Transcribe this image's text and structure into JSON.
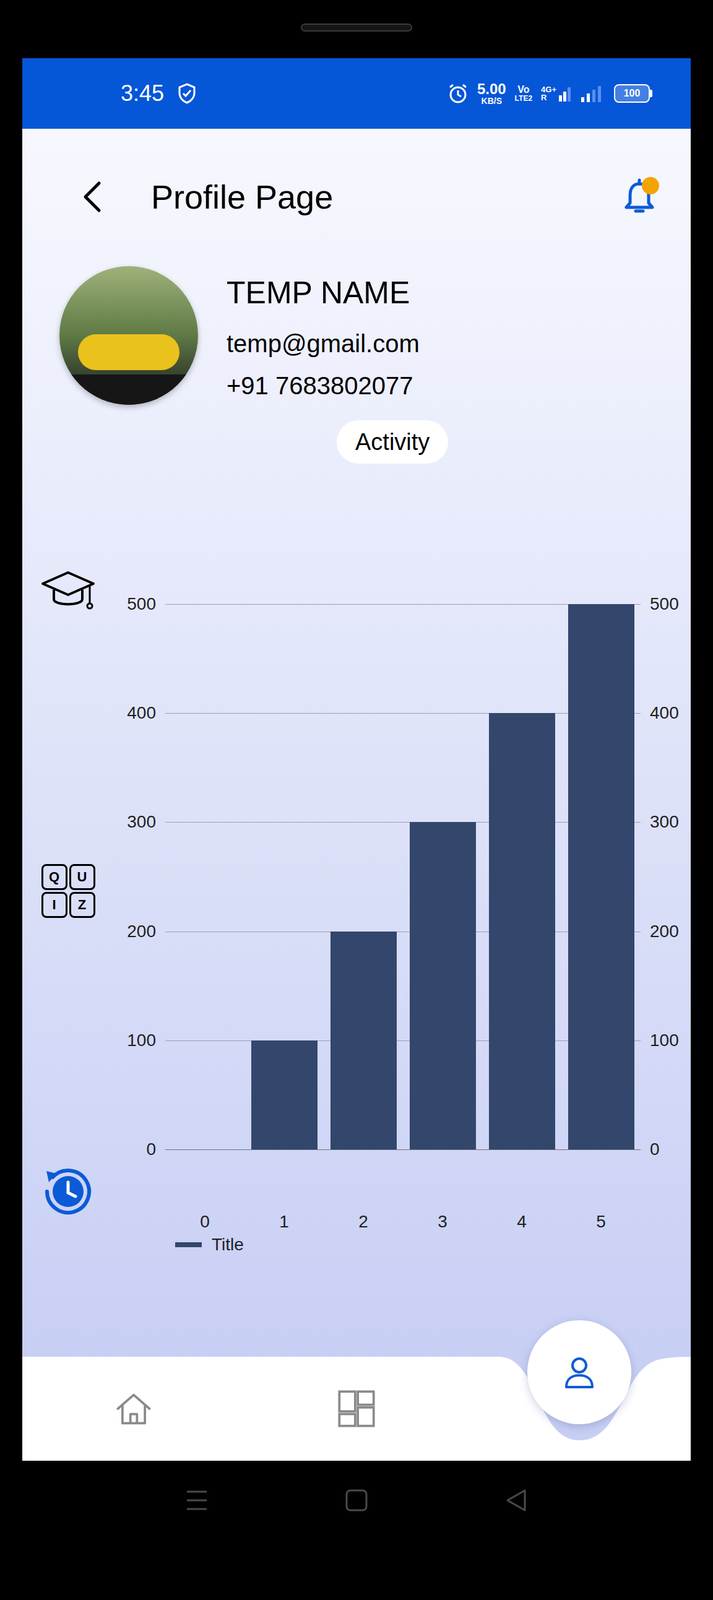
{
  "status_bar": {
    "time": "3:45",
    "speed": "5.00",
    "speed_unit": "KB/S",
    "volte": "Vo",
    "volte_sub": "LTE2",
    "network": "4G+",
    "roaming": "R",
    "battery": "100"
  },
  "header": {
    "title": "Profile Page",
    "notifications": {
      "unread": true
    }
  },
  "profile": {
    "name": "TEMP NAME",
    "email": "temp@gmail.com",
    "phone": "+91 7683802077",
    "activity_button": "Activity"
  },
  "side_menu": [
    {
      "kind": "cap"
    },
    {
      "kind": "quiz",
      "letters": [
        "Q",
        "U",
        "I",
        "Z"
      ]
    },
    {
      "kind": "history"
    }
  ],
  "chart": {
    "y_ticks": [
      "0",
      "100",
      "200",
      "300",
      "400",
      "500"
    ],
    "x_labels": [
      "0",
      "1",
      "2",
      "3",
      "4",
      "5"
    ],
    "series": [
      {
        "name": "Title",
        "values": [
          0,
          100,
          200,
          300,
          400,
          500
        ]
      }
    ]
  },
  "bottom_nav": [
    {
      "kind": "home",
      "selected": false
    },
    {
      "kind": "grid",
      "selected": false
    },
    {
      "kind": "person",
      "selected": true
    }
  ]
}
